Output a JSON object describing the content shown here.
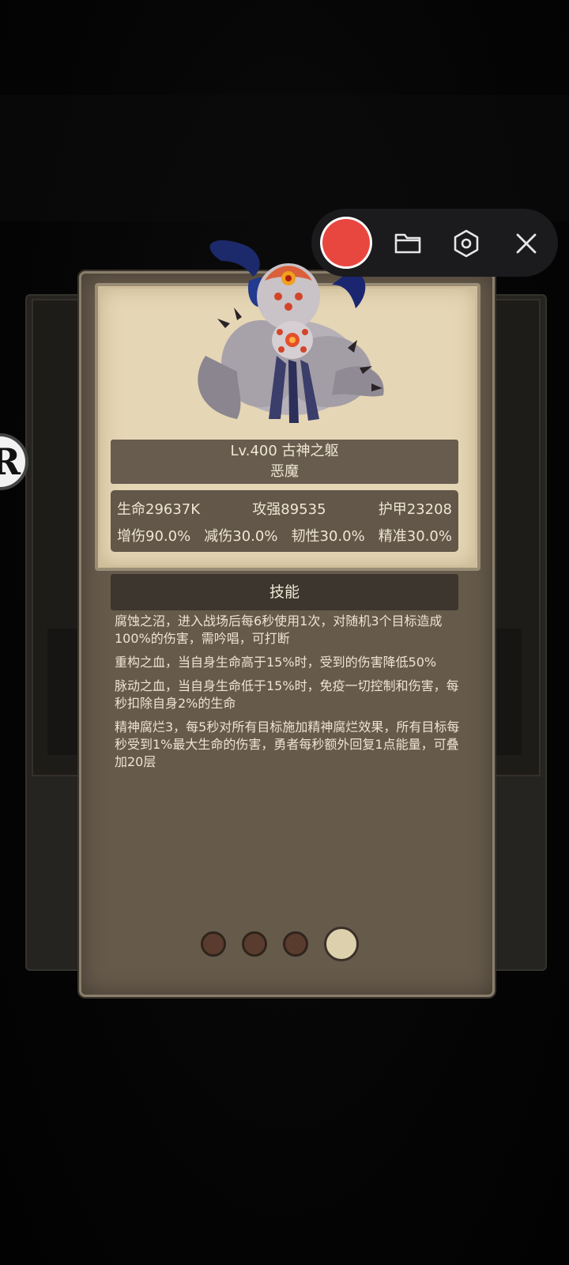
{
  "monster": {
    "title": "Lv.400 古神之躯",
    "type": "恶魔",
    "monster_icon": "spider-demon-monster"
  },
  "stats": {
    "row1": [
      "生命29637K",
      "攻强89535",
      "护甲23208"
    ],
    "row2": [
      "增伤90.0%",
      "减伤30.0%",
      "韧性30.0%",
      "精准30.0%"
    ]
  },
  "skills_header": "技能",
  "skills": [
    "腐蚀之沼，进入战场后每6秒使用1次，对随机3个目标造成100%的伤害，需吟唱，可打断",
    "重构之血，当自身生命高于15%时，受到的伤害降低50%",
    "脉动之血，当自身生命低于15%时，免疫一切控制和伤害，每秒扣除自身2%的生命",
    "精神腐烂3，每5秒对所有目标施加精神腐烂效果，所有目标每秒受到1%最大生命的伤害，勇者每秒额外回复1点能量，可叠加20层"
  ],
  "pagination": {
    "total": 4,
    "active": 4
  },
  "toolbar": {
    "icons": [
      "record-icon",
      "folder-icon",
      "settings-hex-icon",
      "close-icon"
    ],
    "record_color": "#e8473f"
  },
  "side_badge": {
    "letter": "R"
  }
}
